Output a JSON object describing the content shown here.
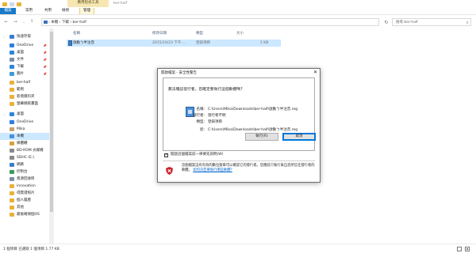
{
  "ribbon": {
    "context_group": "應用程式工具",
    "window_title": "ber-half",
    "tabs": [
      "檔案",
      "常用",
      "共用",
      "檢視",
      "管理"
    ]
  },
  "address": {
    "crumb": "›  本機  ›  下載  ›  ber-half",
    "search_placeholder": "搜尋 ber-half"
  },
  "nav": {
    "items": [
      {
        "label": "快速存取",
        "icon": "star-icon",
        "color": "#3a7bd5",
        "expand": "›",
        "pin": ""
      },
      {
        "label": "OneDrive",
        "icon": "cloud-icon",
        "color": "#2f7de0",
        "expand": "",
        "pin": "📌"
      },
      {
        "label": "桌面",
        "icon": "desktop-icon",
        "color": "#2b87d8",
        "expand": "",
        "pin": "📌"
      },
      {
        "label": "文件",
        "icon": "document-icon",
        "color": "#7a8ea8",
        "expand": "",
        "pin": "📌"
      },
      {
        "label": "下載",
        "icon": "download-icon",
        "color": "#2b87d8",
        "expand": "",
        "pin": "📌"
      },
      {
        "label": "圖片",
        "icon": "pictures-icon",
        "color": "#3a9bd8",
        "expand": "",
        "pin": "📌"
      },
      {
        "label": "ber-half",
        "icon": "folder-icon",
        "color": "#e8b23a",
        "expand": "",
        "pin": ""
      },
      {
        "label": "範例",
        "icon": "folder-icon",
        "color": "#e8b23a",
        "expand": "",
        "pin": ""
      },
      {
        "label": "新增資料夾",
        "icon": "folder-icon",
        "color": "#e8b23a",
        "expand": "",
        "pin": ""
      },
      {
        "label": "螢幕擷取畫面",
        "icon": "folder-icon",
        "color": "#e8b23a",
        "expand": "",
        "pin": ""
      },
      {
        "label": "桌面",
        "icon": "desktop-icon",
        "color": "#2b87d8",
        "expand": "⌄",
        "pin": ""
      },
      {
        "label": "OneDrive",
        "icon": "cloud-icon",
        "color": "#2f7de0",
        "expand": "",
        "pin": ""
      },
      {
        "label": "Mika",
        "icon": "user-icon",
        "color": "#c8a06a",
        "expand": "",
        "pin": ""
      },
      {
        "label": "本機",
        "icon": "computer-icon",
        "color": "#4a90d9",
        "expand": "",
        "pin": ""
      },
      {
        "label": "媒體櫃",
        "icon": "library-icon",
        "color": "#d8a23a",
        "expand": "",
        "pin": ""
      },
      {
        "label": "BD-ROM 光碟機",
        "icon": "disc-icon",
        "color": "#8a8a8a",
        "expand": "",
        "pin": ""
      },
      {
        "label": "SDHC (E:)",
        "icon": "sd-card-icon",
        "color": "#8a8a8a",
        "expand": "",
        "pin": ""
      },
      {
        "label": "網路",
        "icon": "network-icon",
        "color": "#3b7fc8",
        "expand": "",
        "pin": ""
      },
      {
        "label": "控制台",
        "icon": "control-panel-icon",
        "color": "#3b9b5a",
        "expand": "",
        "pin": ""
      },
      {
        "label": "資源回收筒",
        "icon": "recycle-bin-icon",
        "color": "#7a8ea8",
        "expand": "",
        "pin": ""
      },
      {
        "label": "innovation",
        "icon": "folder-icon",
        "color": "#e8b23a",
        "expand": "",
        "pin": ""
      },
      {
        "label": "得獎證照片",
        "icon": "folder-icon",
        "color": "#e8b23a",
        "expand": "",
        "pin": ""
      },
      {
        "label": "個人履歷",
        "icon": "folder-icon",
        "color": "#e8b23a",
        "expand": "",
        "pin": ""
      },
      {
        "label": "其他",
        "icon": "folder-icon",
        "color": "#e8b23a",
        "expand": "",
        "pin": ""
      },
      {
        "label": "最後確保個OS",
        "icon": "folder-icon",
        "color": "#e8b23a",
        "expand": "",
        "pin": ""
      }
    ]
  },
  "filelist": {
    "columns": [
      "名稱",
      "修改日期",
      "類型",
      "大小"
    ],
    "rows": [
      {
        "name": "啟動ㄅ半注音",
        "date": "2015/10/23 下午 ...",
        "type": "登錄項目",
        "size": "2 KB"
      }
    ]
  },
  "status": {
    "text": "1 個項目    已選取 1 個項目  1.77 KB"
  },
  "dialog": {
    "title": "開啟檔案 - 安全性警告",
    "close": "✕",
    "question": "無法確認發行者，您確定要執行這個軟體嗎?",
    "fields": [
      {
        "label": "名稱:",
        "value": "C:\\Users\\Mika\\Downloads\\ber-half\\啟動ㄅ半注音.reg"
      },
      {
        "label": "發行者:",
        "value": "發行者不明"
      },
      {
        "label": "類型:",
        "value": "登錄項目"
      },
      {
        "label": "從:",
        "value": "C:\\Users\\Mika\\Downloads\\ber-half\\啟動ㄅ半注音.reg"
      }
    ],
    "run_button": "執行(R)",
    "cancel_button": "取消",
    "checkbox_label": "開啟這個檔案前一律要先詢問(W)",
    "checkbox_checked": true,
    "warning_text": "這個檔案沒有有效的數位簽章可以確認它的發行者。您應該只執行來自您所信任發行者的軟體。",
    "warning_link": "如何決定要執行哪些軟體?"
  },
  "colors": {
    "accent": "#1979ca",
    "selection": "#cce8ff",
    "context_tab": "#f6e7b2",
    "link": "#0066cc"
  }
}
